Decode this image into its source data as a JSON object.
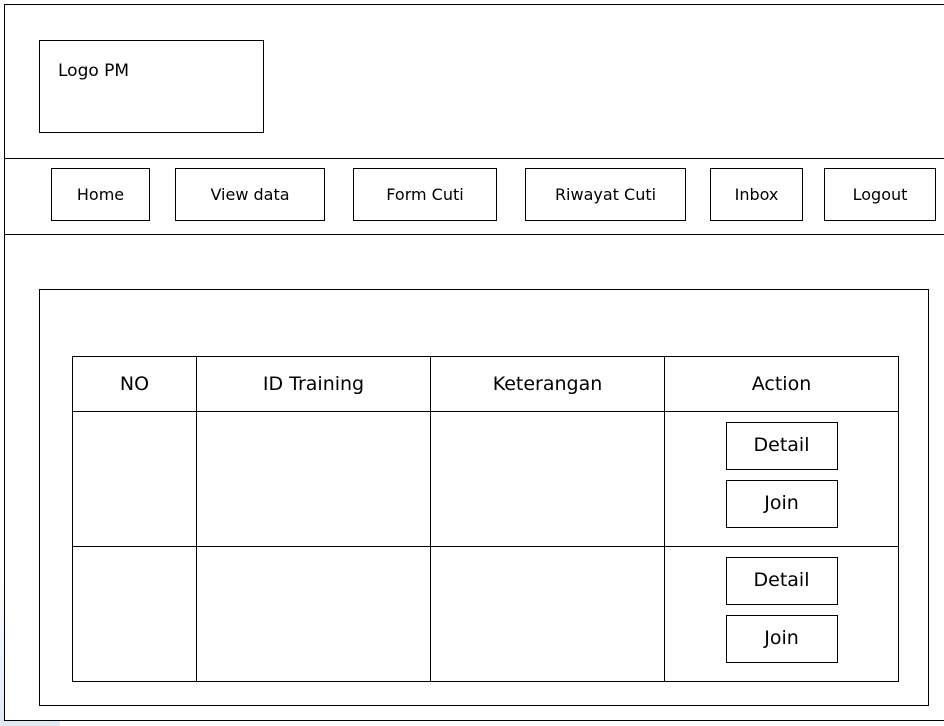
{
  "logo": {
    "label": "Logo PM"
  },
  "nav": [
    {
      "label": "Home"
    },
    {
      "label": "View data"
    },
    {
      "label": "Form Cuti"
    },
    {
      "label": "Riwayat Cuti"
    },
    {
      "label": "Inbox"
    },
    {
      "label": "Logout"
    }
  ],
  "table": {
    "headers": [
      "NO",
      "ID Training",
      "Keterangan",
      "Action"
    ],
    "rows": [
      {
        "no": "",
        "id_training": "",
        "keterangan": "",
        "detail_label": "Detail",
        "join_label": "Join"
      },
      {
        "no": "",
        "id_training": "",
        "keterangan": "",
        "detail_label": "Detail",
        "join_label": "Join"
      }
    ]
  }
}
